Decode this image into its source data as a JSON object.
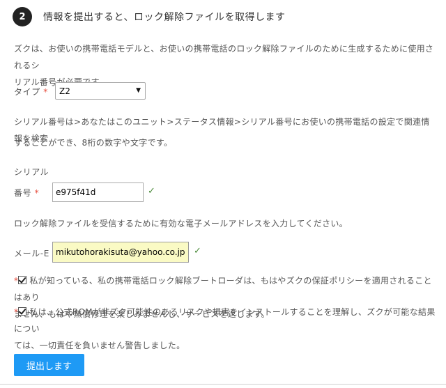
{
  "step": {
    "number": "2",
    "title": "情報を提出すると、ロック解除ファイルを取得します"
  },
  "intro": {
    "line1": "ズクは、お使いの携帯電話モデルと、お使いの携帯電話のロック解除ファイルのために生成するために使用されるシ",
    "line2": "リアル番号が必要です。"
  },
  "type_field": {
    "label": "タイプ",
    "required_mark": "*",
    "selected": "Z2"
  },
  "serial_help": {
    "line1": "シリアル番号は>あなたはこのユニット>ステータス情報>シリアル番号にお使いの携帯電話の設定で関連情報を検索",
    "line2": "することができ、8桁の数字や文字です。"
  },
  "serial_field": {
    "label_top": "シリアル",
    "label_bottom": "番号",
    "required_mark": "*",
    "value": "e975f41d",
    "valid_icon": "✓"
  },
  "email_help": "ロック解除ファイルを受信するために有効な電子メールアドレスを入力してください。",
  "email_field": {
    "label": "メール-E",
    "required_mark": "*",
    "value": "mikutohorakisuta@yahoo.co.jp",
    "valid_icon": "✓"
  },
  "agreements": [
    {
      "required_mark": "*",
      "line1": "私が知っている、私の携帯電話ロック解除ブートローダは、もはやズクの保証ポリシーを適用されることはあり",
      "line2": "ません、もはや無償修理を楽しみませんし、サービスを返します。"
    },
    {
      "required_mark": "*",
      "line1": "私は、公式ROMが非ズク可能性のあるリスクや損害をインストールすることを理解し、ズクが可能な結果につい",
      "line2": "ては、一切責任を負いません警告しました。"
    }
  ],
  "submit_label": "提出します",
  "colors": {
    "accent": "#1e9af5",
    "required": "#e74c3c",
    "valid": "#4a8a3a",
    "highlight_input": "#fafac4"
  }
}
